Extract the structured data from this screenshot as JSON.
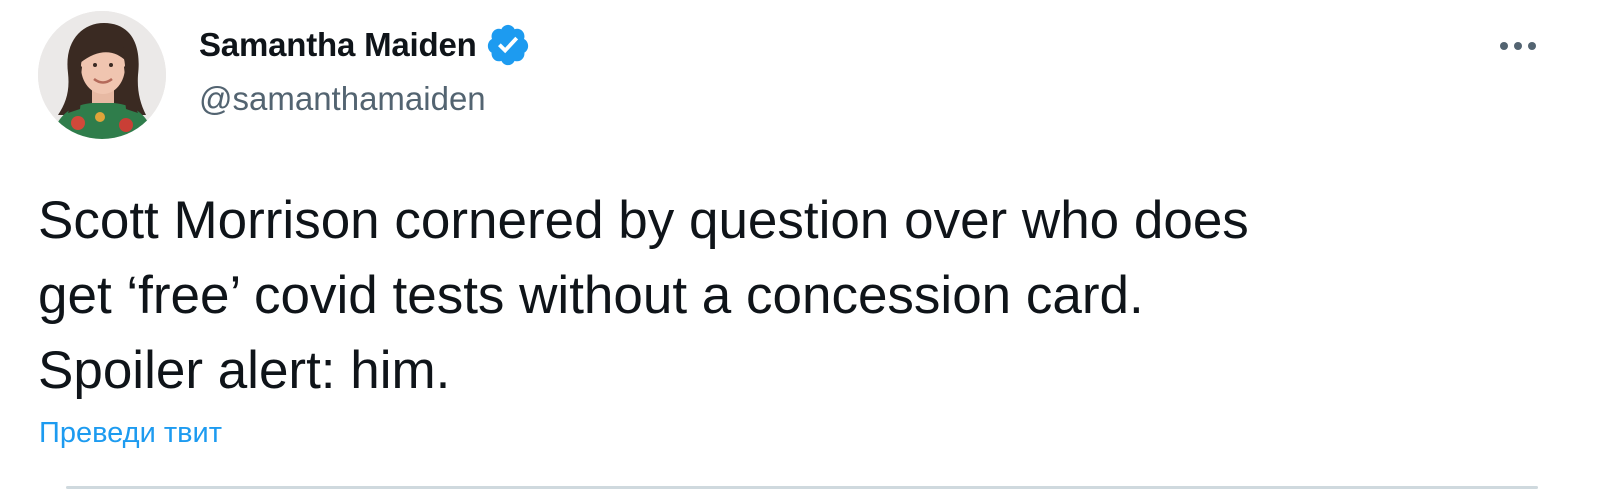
{
  "author": {
    "display_name": "Samantha Maiden",
    "handle": "@samanthamaiden",
    "verified": true,
    "verified_color": "#1d9bf0",
    "avatar_icon": "profile-photo"
  },
  "tweet": {
    "lines": [
      "Scott Morrison cornered by question over who does",
      "get ‘free’ covid tests without a concession card.",
      "Spoiler alert: him."
    ],
    "translate_label": "Преведи твит"
  },
  "menu": {
    "icon": "more-horizontal-icon"
  },
  "colors": {
    "text": "#0f1419",
    "secondary": "#536471",
    "link": "#1d9bf0",
    "divider": "#cfd9de"
  }
}
